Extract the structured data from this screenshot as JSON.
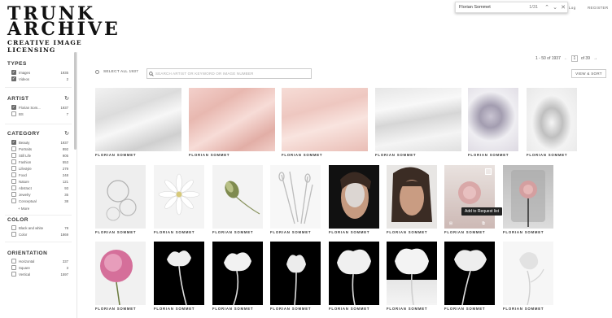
{
  "brand": {
    "line1": "TRUNK",
    "line2": "ARCHIVE",
    "tagline": "CREATIVE IMAGE LICENSING"
  },
  "find_bar": {
    "query": "Florian Sommet",
    "count": "1/31"
  },
  "header": {
    "login": "Log",
    "register": "REGISTER"
  },
  "filters": {
    "types": {
      "title": "TYPES",
      "items": [
        {
          "label": "Images",
          "count": "1935",
          "checked": true
        },
        {
          "label": "Videos",
          "count": "2",
          "checked": true
        }
      ]
    },
    "artist": {
      "title": "ARTIST",
      "items": [
        {
          "label": "Florian Som...",
          "count": "1937",
          "checked": true
        },
        {
          "label": "BS",
          "count": "7",
          "checked": false
        }
      ]
    },
    "category": {
      "title": "CATEGORY",
      "items": [
        {
          "label": "Beauty",
          "count": "1937",
          "checked": true
        },
        {
          "label": "Portraits",
          "count": "892",
          "checked": false
        },
        {
          "label": "Still Life",
          "count": "905",
          "checked": false
        },
        {
          "label": "Fashion",
          "count": "553",
          "checked": false
        },
        {
          "label": "Lifestyle",
          "count": "279",
          "checked": false
        },
        {
          "label": "Food",
          "count": "248",
          "checked": false
        },
        {
          "label": "Nature",
          "count": "121",
          "checked": false
        },
        {
          "label": "Abstract",
          "count": "93",
          "checked": false
        },
        {
          "label": "Jewelry",
          "count": "35",
          "checked": false
        },
        {
          "label": "Conceptual",
          "count": "38",
          "checked": false
        }
      ],
      "more": "More"
    },
    "color": {
      "title": "COLOR",
      "items": [
        {
          "label": "Black and white",
          "count": "78",
          "checked": false
        },
        {
          "label": "Color",
          "count": "1869",
          "checked": false
        }
      ]
    },
    "orientation": {
      "title": "ORIENTATION",
      "items": [
        {
          "label": "Horizontal",
          "count": "337",
          "checked": false
        },
        {
          "label": "Square",
          "count": "3",
          "checked": false
        },
        {
          "label": "Vertical",
          "count": "1597",
          "checked": false
        }
      ]
    }
  },
  "toolbar": {
    "select_all": "SELECT ALL 1937",
    "search_placeholder": "SEARCH ARTIST OR KEYWORD OR IMAGE NUMBER",
    "range": "1 - 50 of 1937",
    "page": "1",
    "of_pages": "of 39",
    "view_sort": "VIEW & SORT"
  },
  "results": {
    "caption": "FLORIAN SOMMET",
    "tooltip": "Add to Request list"
  },
  "icons": {
    "search": "search-icon",
    "reset": "refresh-icon",
    "prev": "chevron-left-icon",
    "next": "chevron-right-icon",
    "close": "close-icon"
  }
}
